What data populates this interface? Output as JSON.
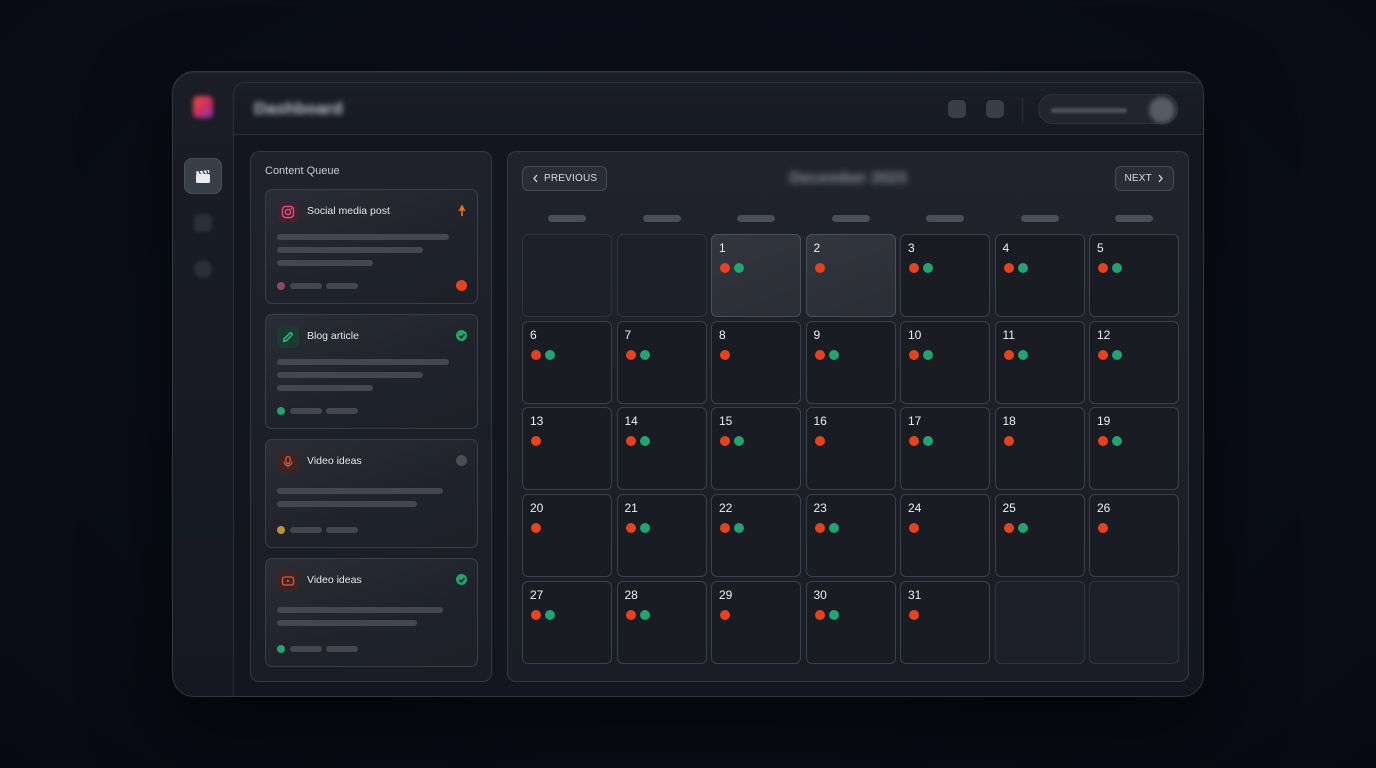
{
  "header": {
    "title": "Dashboard"
  },
  "queue": {
    "title": "Content Queue",
    "cards": [
      {
        "title": "Social media post",
        "icon": "instagram-icon",
        "status": "flag-icon",
        "color": "#e0386c"
      },
      {
        "title": "Blog article",
        "icon": "pencil-icon",
        "status": "check-icon",
        "color": "#22a36f"
      },
      {
        "title": "Video ideas",
        "icon": "microphone-icon",
        "status": "pending-icon",
        "color": "#e5431e"
      },
      {
        "title": "Video ideas",
        "icon": "video-icon",
        "status": "check-icon",
        "color": "#e5431e"
      }
    ]
  },
  "calendar": {
    "title": "December 2023",
    "prev_label": "PREVIOUS",
    "next_label": "NEXT",
    "days": [
      {
        "n": "",
        "dots": []
      },
      {
        "n": "",
        "dots": []
      },
      {
        "n": "1",
        "dots": [
          "r",
          "g"
        ]
      },
      {
        "n": "2",
        "dots": [
          "r"
        ]
      },
      {
        "n": "3",
        "dots": [
          "r",
          "g"
        ]
      },
      {
        "n": "4",
        "dots": [
          "r",
          "g"
        ]
      },
      {
        "n": "5",
        "dots": [
          "r",
          "g"
        ]
      },
      {
        "n": "6",
        "dots": [
          "r",
          "g"
        ]
      },
      {
        "n": "7",
        "dots": [
          "r",
          "g"
        ]
      },
      {
        "n": "8",
        "dots": [
          "r"
        ]
      },
      {
        "n": "9",
        "dots": [
          "r",
          "g"
        ]
      },
      {
        "n": "10",
        "dots": [
          "r",
          "g"
        ]
      },
      {
        "n": "11",
        "dots": [
          "r",
          "g"
        ]
      },
      {
        "n": "12",
        "dots": [
          "r",
          "g"
        ]
      },
      {
        "n": "13",
        "dots": [
          "r"
        ]
      },
      {
        "n": "14",
        "dots": [
          "r",
          "g"
        ]
      },
      {
        "n": "15",
        "dots": [
          "r",
          "g"
        ]
      },
      {
        "n": "16",
        "dots": [
          "r"
        ]
      },
      {
        "n": "17",
        "dots": [
          "r",
          "g"
        ]
      },
      {
        "n": "18",
        "dots": [
          "r"
        ]
      },
      {
        "n": "19",
        "dots": [
          "r",
          "g"
        ]
      },
      {
        "n": "20",
        "dots": [
          "r"
        ]
      },
      {
        "n": "21",
        "dots": [
          "r",
          "g"
        ]
      },
      {
        "n": "22",
        "dots": [
          "r",
          "g"
        ]
      },
      {
        "n": "23",
        "dots": [
          "r",
          "g"
        ]
      },
      {
        "n": "24",
        "dots": [
          "r"
        ]
      },
      {
        "n": "25",
        "dots": [
          "r",
          "g"
        ]
      },
      {
        "n": "26",
        "dots": [
          "r"
        ]
      },
      {
        "n": "27",
        "dots": [
          "r",
          "g"
        ]
      },
      {
        "n": "28",
        "dots": [
          "r",
          "g"
        ]
      },
      {
        "n": "29",
        "dots": [
          "r"
        ]
      },
      {
        "n": "30",
        "dots": [
          "r",
          "g"
        ]
      },
      {
        "n": "31",
        "dots": [
          "r"
        ]
      },
      {
        "n": "",
        "dots": []
      },
      {
        "n": "",
        "dots": []
      }
    ],
    "highlighted": [
      "1",
      "2"
    ]
  },
  "colors": {
    "red": "#e5431e",
    "green": "#22a36f"
  }
}
